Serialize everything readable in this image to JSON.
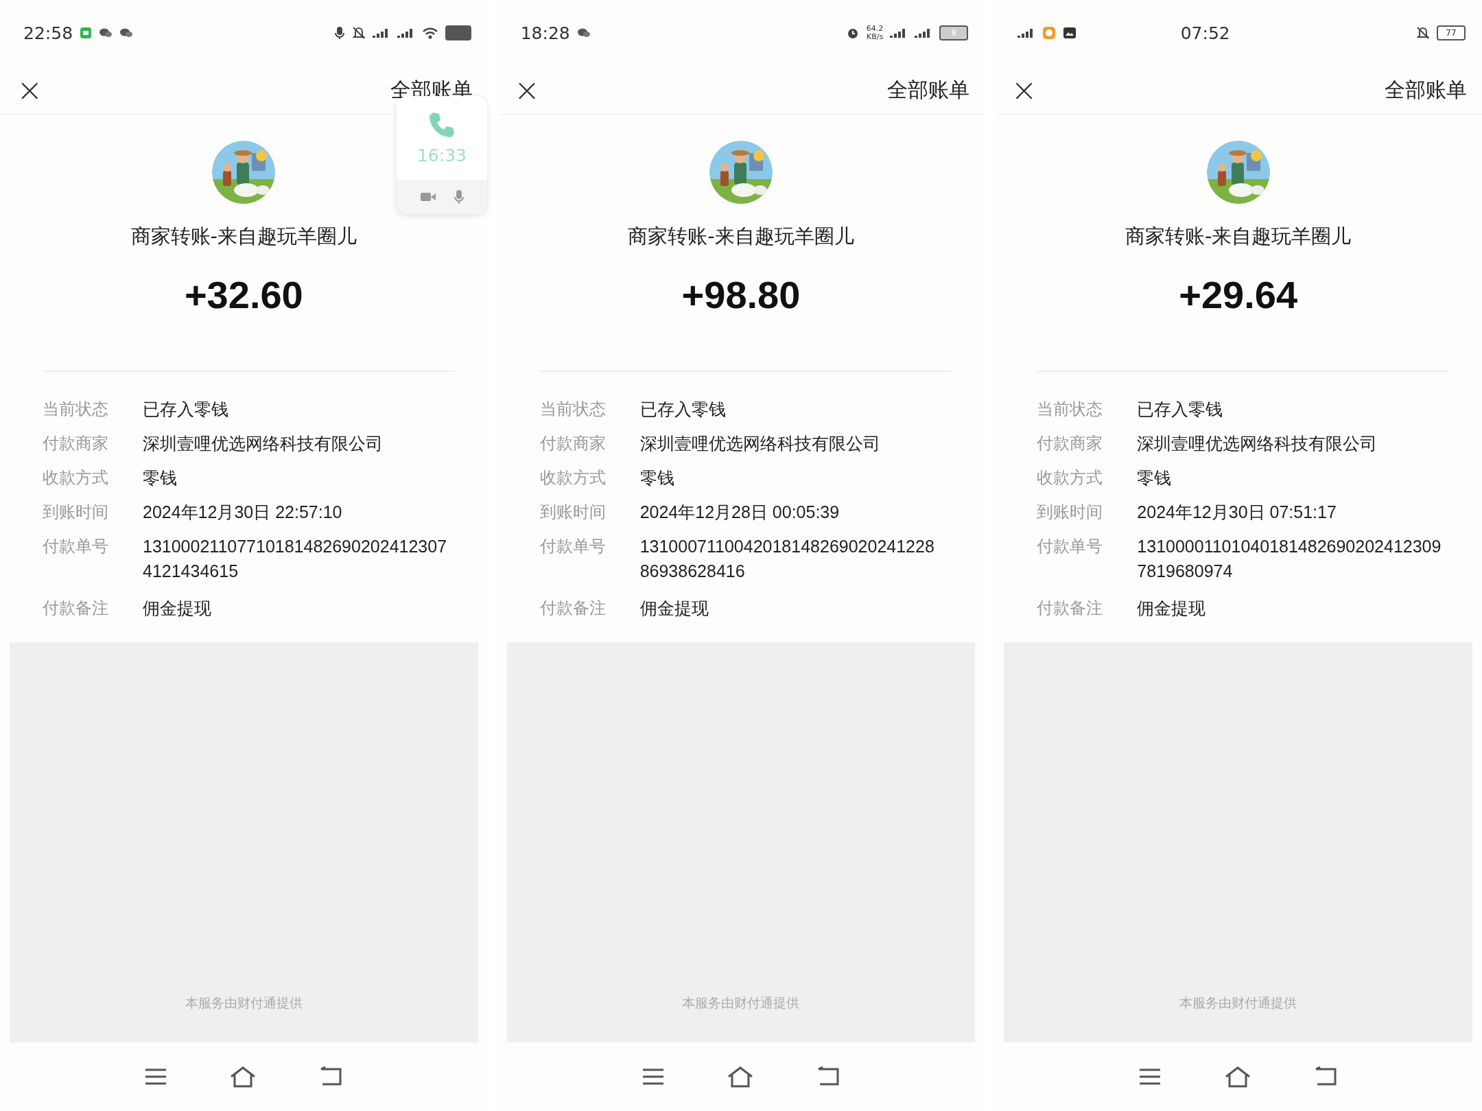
{
  "panels": [
    {
      "status_bar": {
        "time": "22:58"
      },
      "header": {
        "close": "×",
        "all_bills": "全部账单"
      },
      "call_overlay": {
        "duration": "16:33"
      },
      "merchant": "商家转账-来自趣玩羊圈儿",
      "amount": "+32.60",
      "details": [
        {
          "label": "当前状态",
          "value": "已存入零钱"
        },
        {
          "label": "付款商家",
          "value": "深圳壹哩优选网络科技有限公司"
        },
        {
          "label": "收款方式",
          "value": "零钱"
        },
        {
          "label": "到账时间",
          "value": "2024年12月30日 22:57:10"
        },
        {
          "label": "付款单号",
          "value": "13100021107710181482690202412307 4121434615"
        },
        {
          "label": "付款备注",
          "value": "佣金提现"
        }
      ],
      "footer": "本服务由财付通提供"
    },
    {
      "status_bar": {
        "time": "18:28",
        "net_speed": "64.2",
        "net_unit": "KB/s",
        "battery": "8"
      },
      "header": {
        "close": "×",
        "all_bills": "全部账单"
      },
      "merchant": "商家转账-来自趣玩羊圈儿",
      "amount": "+98.80",
      "details": [
        {
          "label": "当前状态",
          "value": "已存入零钱"
        },
        {
          "label": "付款商家",
          "value": "深圳壹哩优选网络科技有限公司"
        },
        {
          "label": "收款方式",
          "value": "零钱"
        },
        {
          "label": "到账时间",
          "value": "2024年12月28日 00:05:39"
        },
        {
          "label": "付款单号",
          "value": "1310007110042018148269020241228 86938628416"
        },
        {
          "label": "付款备注",
          "value": "佣金提现"
        }
      ],
      "footer": "本服务由财付通提供"
    },
    {
      "status_bar": {
        "time": "07:52",
        "battery": "77"
      },
      "header": {
        "close": "×",
        "all_bills": "全部账单"
      },
      "merchant": "商家转账-来自趣玩羊圈儿",
      "amount": "+29.64",
      "details": [
        {
          "label": "当前状态",
          "value": "已存入零钱"
        },
        {
          "label": "付款商家",
          "value": "深圳壹哩优选网络科技有限公司"
        },
        {
          "label": "收款方式",
          "value": "零钱"
        },
        {
          "label": "到账时间",
          "value": "2024年12月30日 07:51:17"
        },
        {
          "label": "付款单号",
          "value": "13100001101040181482690202412309 7819680974"
        },
        {
          "label": "付款备注",
          "value": "佣金提现"
        }
      ],
      "footer": "本服务由财付通提供"
    }
  ]
}
